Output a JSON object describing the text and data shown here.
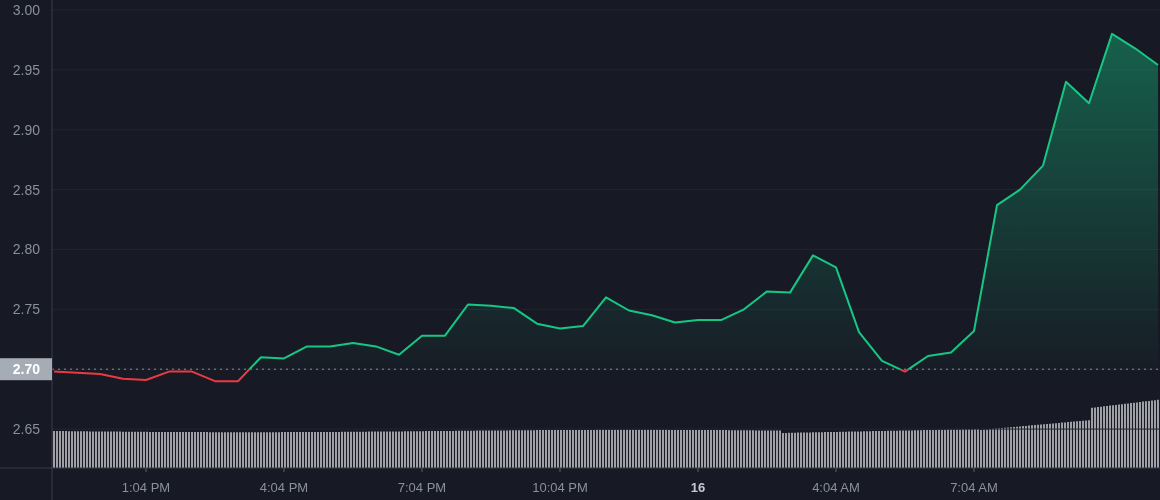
{
  "chart": {
    "chart_data": {
      "type": "area",
      "grid": true,
      "categories": [
        null,
        null,
        null,
        null,
        "1:04 PM",
        null,
        null,
        null,
        null,
        null,
        "4:04 PM",
        null,
        null,
        null,
        null,
        null,
        "7:04 PM",
        null,
        null,
        null,
        null,
        null,
        "10:04 PM",
        null,
        null,
        null,
        null,
        null,
        "16",
        null,
        null,
        null,
        null,
        null,
        "4:04 AM",
        null,
        null,
        null,
        null,
        null,
        "7:04 AM",
        null,
        null,
        null,
        null,
        null,
        null,
        null,
        null
      ],
      "series": [
        {
          "color": "#16c784",
          "values": [
            2.698,
            2.697,
            2.696,
            2.692,
            2.691,
            2.698,
            2.698,
            2.69,
            2.69,
            2.71,
            2.709,
            2.719,
            2.719,
            2.722,
            2.719,
            2.712,
            2.728,
            2.728,
            2.754,
            2.753,
            2.751,
            2.738,
            2.734,
            2.736,
            2.76,
            2.749,
            2.745,
            2.739,
            2.741,
            2.741,
            2.75,
            2.765,
            2.764,
            2.795,
            2.785,
            2.731,
            2.707,
            2.698,
            2.711,
            2.714,
            2.732,
            2.837,
            2.85,
            2.87,
            2.94,
            2.922,
            2.98,
            2.968,
            2.954
          ]
        }
      ],
      "ylim": [
        2.6175,
        3.0083
      ],
      "yticks": [
        {
          "value": 2.65,
          "label": "2.65"
        },
        {
          "value": 2.7,
          "label": "2.70"
        },
        {
          "value": 2.75,
          "label": "2.75"
        },
        {
          "value": 2.8,
          "label": "2.80"
        },
        {
          "value": 2.85,
          "label": "2.85"
        },
        {
          "value": 2.9,
          "label": "2.90"
        },
        {
          "value": 2.95,
          "label": "2.95"
        },
        {
          "value": 3.0,
          "label": "3.00"
        }
      ],
      "ref_lines": [
        {
          "axis": "y",
          "value": 2.7
        }
      ]
    }
  }
}
